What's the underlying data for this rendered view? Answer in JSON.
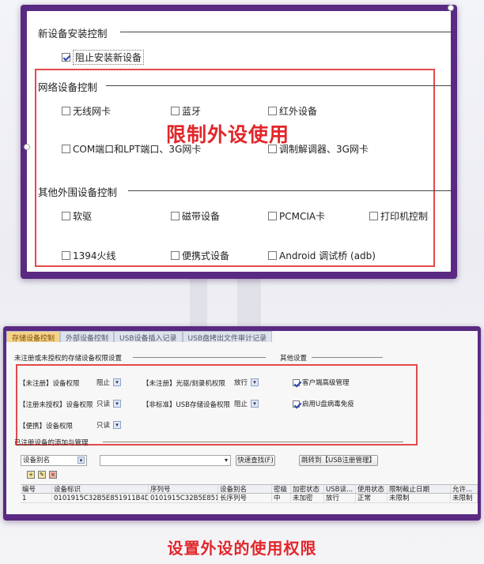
{
  "panel1": {
    "section_new": "新设备安装控制",
    "block_install": "阻止安装新设备",
    "section_network": "网络设备控制",
    "network_items": [
      "无线网卡",
      "蓝牙",
      "红外设备",
      "COM端口和LPT端口、3G网卡",
      "调制解调器、3G网卡"
    ],
    "section_other": "其他外围设备控制",
    "other_items": [
      "软驱",
      "磁带设备",
      "PCMCIA卡",
      "打印机控制",
      "1394火线",
      "便携式设备",
      "Android 调试桥 (adb)"
    ],
    "overlay_title": "限制外设使用"
  },
  "panel2": {
    "tabs": [
      "存储设备控制",
      "外部设备控制",
      "USB设备插入记录",
      "USB盘拷出文件审计记录"
    ],
    "section_unreg": "未注册或未授权的存储设备权限设置",
    "section_other": "其他设置",
    "perm_rows": [
      {
        "label": "【未注册】设备权限",
        "value": "阻止"
      },
      {
        "label": "【注册未授权】设备权限",
        "value": "只读"
      },
      {
        "label": "【便携】设备权限",
        "value": "只读"
      }
    ],
    "perm_rows_right": [
      {
        "label": "【未注册】光驱/刻录机权限",
        "value": "放行"
      },
      {
        "label": "【非标准】USB存储设备权限",
        "value": "阻止"
      }
    ],
    "other_settings": [
      "客户端高级管理",
      "启用U盘病毒免疫"
    ],
    "section_add": "已注册设备的添加与管理",
    "filter_field": "设备别名",
    "quick_find": "快速查找(F)",
    "jump_button": "跳转到【USB注册管理】",
    "table": {
      "headers": [
        "编号",
        "设备标识",
        "序列号",
        "设备别名",
        "密级",
        "加密状态",
        "USB读...",
        "使用状态",
        "限制截止日期",
        "允许..."
      ],
      "rows": [
        [
          "1",
          "0101915C32B5E851911B4DAD9...",
          "0101915C32B5E8519...",
          "长序列号",
          "中",
          "未加密",
          "放行",
          "正常",
          "未限制",
          "未限制"
        ]
      ]
    }
  },
  "caption": "设置外设的使用权限",
  "colors": {
    "frame": "#5a2a82",
    "accent_red": "#e2262a",
    "red_box": "#e34a4a"
  }
}
